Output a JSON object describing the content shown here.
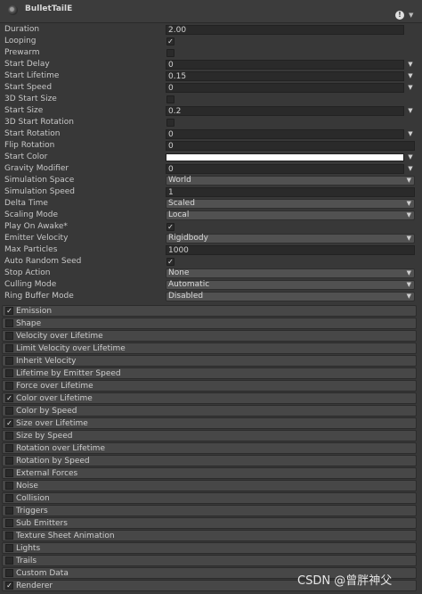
{
  "header": {
    "title": "BulletTailE",
    "icon": "particle-system-icon",
    "info_icon": "!"
  },
  "properties": [
    {
      "label": "Duration",
      "kind": "field",
      "value": "2.00"
    },
    {
      "label": "Looping",
      "kind": "check",
      "checked": true
    },
    {
      "label": "Prewarm",
      "kind": "check",
      "checked": false
    },
    {
      "label": "Start Delay",
      "kind": "field",
      "value": "0",
      "side": true
    },
    {
      "label": "Start Lifetime",
      "kind": "field",
      "value": "0.15",
      "side": true
    },
    {
      "label": "Start Speed",
      "kind": "field",
      "value": "0",
      "side": true
    },
    {
      "label": "3D Start Size",
      "kind": "check",
      "checked": false
    },
    {
      "label": "Start Size",
      "kind": "field",
      "value": "0.2",
      "side": true
    },
    {
      "label": "3D Start Rotation",
      "kind": "check",
      "checked": false
    },
    {
      "label": "Start Rotation",
      "kind": "field",
      "value": "0",
      "side": true
    },
    {
      "label": "Flip Rotation",
      "kind": "field",
      "value": "0",
      "wide": true
    },
    {
      "label": "Start Color",
      "kind": "color",
      "value": "#ffffff",
      "side": true
    },
    {
      "label": "Gravity Modifier",
      "kind": "field",
      "value": "0",
      "side": true
    },
    {
      "label": "Simulation Space",
      "kind": "dropdown",
      "value": "World"
    },
    {
      "label": "Simulation Speed",
      "kind": "field",
      "value": "1",
      "wide": true
    },
    {
      "label": "Delta Time",
      "kind": "dropdown",
      "value": "Scaled"
    },
    {
      "label": "Scaling Mode",
      "kind": "dropdown",
      "value": "Local"
    },
    {
      "label": "Play On Awake*",
      "kind": "check",
      "checked": true
    },
    {
      "label": "Emitter Velocity",
      "kind": "dropdown",
      "value": "Rigidbody"
    },
    {
      "label": "Max Particles",
      "kind": "field",
      "value": "1000",
      "wide": true
    },
    {
      "label": "Auto Random Seed",
      "kind": "check",
      "checked": true
    },
    {
      "label": "Stop Action",
      "kind": "dropdown",
      "value": "None"
    },
    {
      "label": "Culling Mode",
      "kind": "dropdown",
      "value": "Automatic"
    },
    {
      "label": "Ring Buffer Mode",
      "kind": "dropdown",
      "value": "Disabled"
    }
  ],
  "modules": [
    {
      "label": "Emission",
      "checked": true
    },
    {
      "label": "Shape",
      "checked": false
    },
    {
      "label": "Velocity over Lifetime",
      "checked": false
    },
    {
      "label": "Limit Velocity over Lifetime",
      "checked": false
    },
    {
      "label": "Inherit Velocity",
      "checked": false
    },
    {
      "label": "Lifetime by Emitter Speed",
      "checked": false
    },
    {
      "label": "Force over Lifetime",
      "checked": false
    },
    {
      "label": "Color over Lifetime",
      "checked": true
    },
    {
      "label": "Color by Speed",
      "checked": false
    },
    {
      "label": "Size over Lifetime",
      "checked": true
    },
    {
      "label": "Size by Speed",
      "checked": false
    },
    {
      "label": "Rotation over Lifetime",
      "checked": false
    },
    {
      "label": "Rotation by Speed",
      "checked": false
    },
    {
      "label": "External Forces",
      "checked": false
    },
    {
      "label": "Noise",
      "checked": false
    },
    {
      "label": "Collision",
      "checked": false
    },
    {
      "label": "Triggers",
      "checked": false
    },
    {
      "label": "Sub Emitters",
      "checked": false
    },
    {
      "label": "Texture Sheet Animation",
      "checked": false
    },
    {
      "label": "Lights",
      "checked": false
    },
    {
      "label": "Trails",
      "checked": false
    },
    {
      "label": "Custom Data",
      "checked": false
    },
    {
      "label": "Renderer",
      "checked": true
    }
  ],
  "watermark": "CSDN @曾胖神父"
}
